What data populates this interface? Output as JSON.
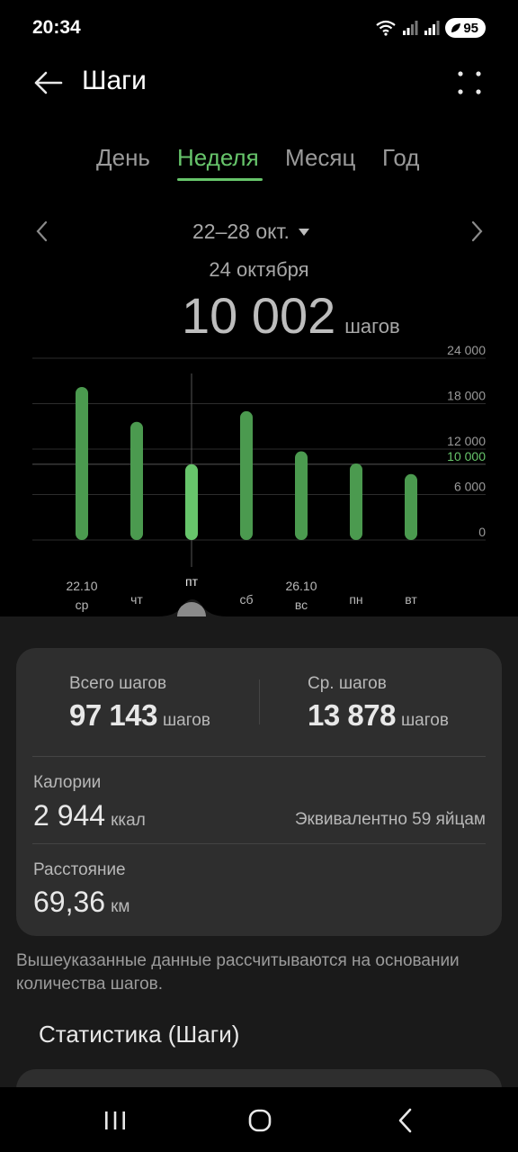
{
  "status_bar": {
    "time": "20:34",
    "battery": "95",
    "icons": [
      "wifi-icon",
      "signal-icon",
      "signal-icon",
      "battery-icon"
    ]
  },
  "app_bar": {
    "title": "Шаги",
    "back_icon": "arrow-left-icon",
    "more_icon": "more-dots-icon"
  },
  "tabs": [
    {
      "label": "День",
      "active": false
    },
    {
      "label": "Неделя",
      "active": true
    },
    {
      "label": "Месяц",
      "active": false
    },
    {
      "label": "Год",
      "active": false
    }
  ],
  "range": {
    "label": "22–28 окт.",
    "prev_icon": "chevron-left-icon",
    "next_icon": "chevron-right-icon",
    "dropdown_icon": "caret-down-icon"
  },
  "selected": {
    "date": "24 октября",
    "value": "10 002",
    "unit": "шагов"
  },
  "colors": {
    "accent": "#67c56b",
    "bar": "#4b9a4f",
    "bar_selected": "#67c56b",
    "card": "#2e2e2e",
    "sheet": "#1a1a1a"
  },
  "chart_data": {
    "type": "bar",
    "categories": [
      "ср",
      "чт",
      "пт",
      "сб",
      "вс",
      "пн",
      "вт"
    ],
    "date_labels": [
      "22.10",
      "",
      "",
      "",
      "26.10",
      "",
      ""
    ],
    "values": [
      20200,
      15600,
      10002,
      17000,
      11700,
      10100,
      8700
    ],
    "selected_index": 2,
    "ylim": [
      0,
      24000
    ],
    "yticks": [
      "24 000",
      "18 000",
      "12 000",
      "6 000",
      "0"
    ],
    "ytick_values": [
      24000,
      18000,
      12000,
      6000,
      0
    ],
    "reference_line": {
      "value": 10000,
      "label": "10 000"
    },
    "grid": true
  },
  "stats": {
    "total": {
      "label": "Всего шагов",
      "value": "97 143",
      "unit": "шагов"
    },
    "average": {
      "label": "Ср. шагов",
      "value": "13 878",
      "unit": "шагов"
    },
    "calories": {
      "label": "Калории",
      "value": "2 944",
      "unit": "ккал",
      "equivalent": "Эквивалентно 59 яйцам"
    },
    "distance": {
      "label": "Расстояние",
      "value": "69,36",
      "unit": "км"
    }
  },
  "note": "Вышеуказанные данные рассчитываются на основании количества шагов.",
  "section_title": "Статистика (Шаги)",
  "nav": {
    "recents_icon": "recents-icon",
    "home_icon": "home-icon",
    "back_icon": "nav-back-icon"
  }
}
